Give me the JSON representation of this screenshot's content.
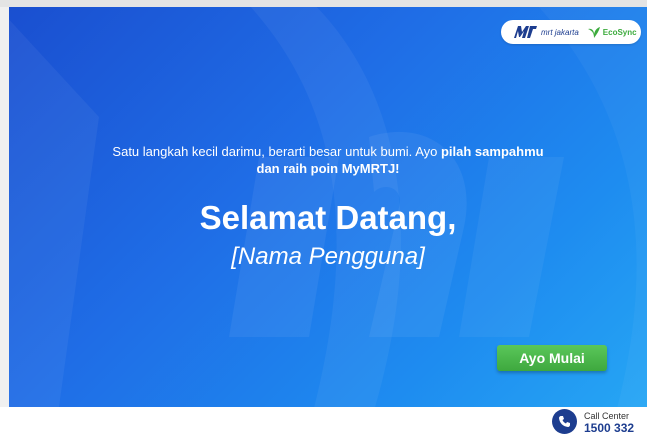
{
  "header": {
    "mrt_brand": "mrt jakarta",
    "eco_brand": "EcoSync"
  },
  "hero": {
    "tagline_plain": "Satu langkah kecil darimu, berarti besar untuk bumi. Ayo ",
    "tagline_bold_1": "pilah sampahmu",
    "tagline_bold_2": "dan raih poin MyMRTJ!",
    "welcome": "Selamat Datang,",
    "username": "[Nama Pengguna]",
    "start_label": "Ayo Mulai"
  },
  "footer": {
    "call_label": "Call Center",
    "call_number": "1500 332"
  },
  "colors": {
    "hero_start": "#1a4fd0",
    "hero_end": "#26a6f4",
    "button_green": "#3ea83e",
    "brand_navy": "#1d3d8f",
    "eco_green": "#3dab3d"
  },
  "icons": [
    "mrt-logo-icon",
    "leaf-icon",
    "phone-icon"
  ]
}
